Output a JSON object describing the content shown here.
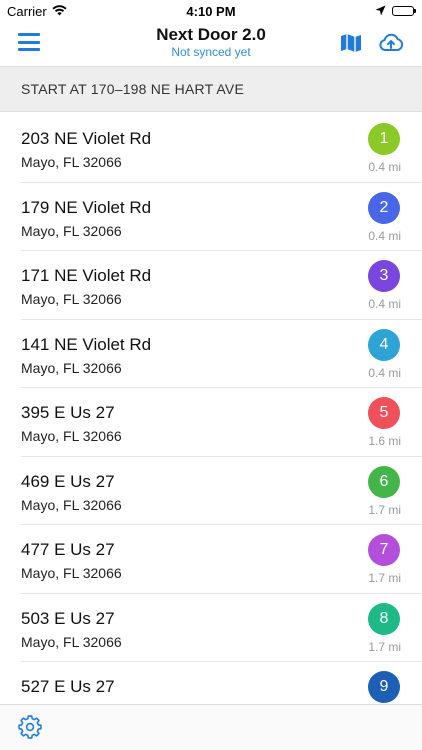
{
  "status_bar": {
    "carrier": "Carrier",
    "time": "4:10 PM"
  },
  "nav": {
    "title": "Next Door 2.0",
    "subtitle": "Not synced yet",
    "icons": {
      "menu": "hamburger-menu-icon",
      "map": "map-icon",
      "sync": "cloud-upload-icon"
    },
    "accent_color": "#1e7be0"
  },
  "section_header": "START AT 170–198 NE HART AVE",
  "stops": [
    {
      "street": "203 NE Violet Rd",
      "city": "Mayo, FL 32066",
      "number": "1",
      "distance": "0.4 mi",
      "color": "#8ac926"
    },
    {
      "street": "179 NE Violet Rd",
      "city": "Mayo, FL 32066",
      "number": "2",
      "distance": "0.4 mi",
      "color": "#4a66e8"
    },
    {
      "street": "171 NE Violet Rd",
      "city": "Mayo, FL 32066",
      "number": "3",
      "distance": "0.4 mi",
      "color": "#7b46e0"
    },
    {
      "street": "141 NE Violet Rd",
      "city": "Mayo, FL 32066",
      "number": "4",
      "distance": "0.4 mi",
      "color": "#2ea3d6"
    },
    {
      "street": "395 E Us 27",
      "city": "Mayo, FL 32066",
      "number": "5",
      "distance": "1.6 mi",
      "color": "#f0505a"
    },
    {
      "street": "469 E Us 27",
      "city": "Mayo, FL 32066",
      "number": "6",
      "distance": "1.7 mi",
      "color": "#43b54b"
    },
    {
      "street": "477 E Us 27",
      "city": "Mayo, FL 32066",
      "number": "7",
      "distance": "1.7 mi",
      "color": "#b44fdc"
    },
    {
      "street": "503 E Us 27",
      "city": "Mayo, FL 32066",
      "number": "8",
      "distance": "1.7 mi",
      "color": "#1fb987"
    },
    {
      "street": "527 E Us 27",
      "city": "",
      "number": "9",
      "distance": "",
      "color": "#1d5fb5"
    }
  ],
  "toolbar": {
    "settings_icon": "gear-icon"
  }
}
